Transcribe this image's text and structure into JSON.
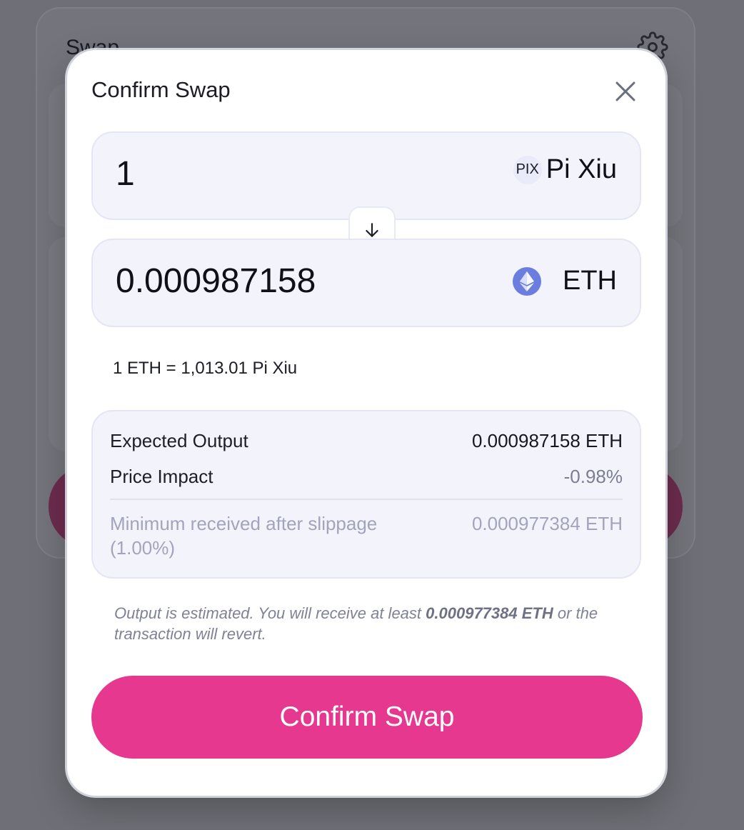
{
  "background": {
    "title": "Swap",
    "settings_icon": "gear-icon"
  },
  "modal": {
    "title": "Confirm Swap",
    "close_icon": "close-icon",
    "from": {
      "amount": "1",
      "token_logo_text": "PIX",
      "token_name": "Pi Xiu"
    },
    "direction_icon": "arrow-down-icon",
    "to": {
      "amount": "0.000987158",
      "token_logo": "eth-icon",
      "token_name": "ETH"
    },
    "rate": "1 ETH = 1,013.01 Pi Xiu",
    "details": {
      "expected_output_label": "Expected Output",
      "expected_output_value": "0.000987158 ETH",
      "price_impact_label": "Price Impact",
      "price_impact_value": "-0.98%",
      "min_received_label": "Minimum received after slippage (1.00%)",
      "min_received_value": "0.000977384 ETH"
    },
    "note": {
      "prefix": "Output is estimated. You will receive at least ",
      "amount": "0.000977384 ETH",
      "suffix": " or the transaction will revert."
    },
    "confirm_label": "Confirm Swap"
  },
  "colors": {
    "accent": "#e6388e",
    "overlay": "#6f6f77",
    "panel": "#f3f4fb",
    "eth": "#6b7ee0"
  }
}
